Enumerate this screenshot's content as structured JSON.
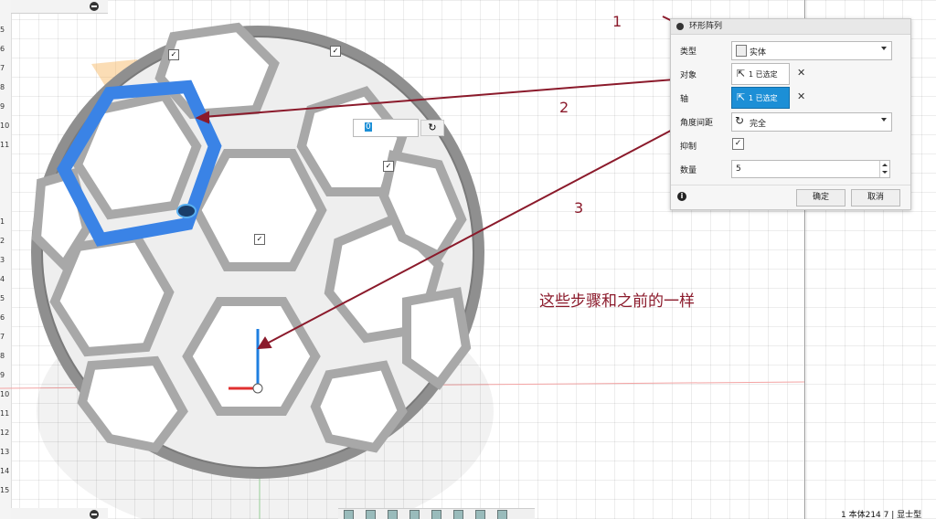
{
  "ruler_upper": [
    "5",
    "6",
    "7",
    "8",
    "9",
    "10",
    "11"
  ],
  "ruler_lower": [
    "1",
    "2",
    "3",
    "4",
    "5",
    "6",
    "7",
    "8",
    "9",
    "10",
    "11",
    "12",
    "13",
    "14",
    "15"
  ],
  "dialog": {
    "title": "环形阵列",
    "rows": {
      "type": {
        "label": "类型",
        "value": "实体"
      },
      "object": {
        "label": "对象",
        "value": "1 已选定"
      },
      "axis": {
        "label": "轴",
        "value": "1 已选定"
      },
      "angle": {
        "label": "角度间距",
        "value": "完全"
      },
      "suppress": {
        "label": "抑制",
        "checked": true
      },
      "count": {
        "label": "数量",
        "value": "5"
      }
    },
    "ok": "确定",
    "cancel": "取消"
  },
  "annotations": {
    "n1": "1",
    "n2": "2",
    "n3": "3",
    "note": "这些步骤和之前的一样"
  },
  "float_input": {
    "value": "0"
  },
  "status_text": "1 本体214 7 | 显士型"
}
